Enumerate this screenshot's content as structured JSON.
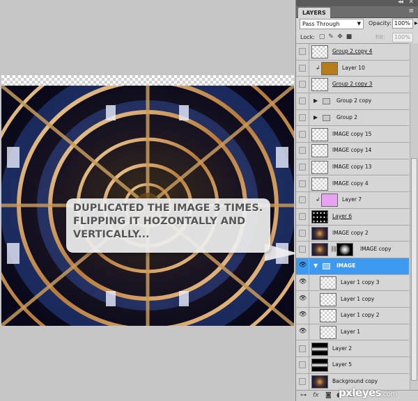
{
  "canvas": {
    "callout": {
      "lines": [
        "DUPLICATED THE IMAGE 3 TIMES.",
        "FLIPPING IT HOZONTALLY AND",
        "VERTICALLY..."
      ]
    }
  },
  "panel": {
    "tab_label": "LAYERS",
    "collapse_glyph": "◂◂",
    "close_glyph": "✕",
    "menu_glyph": "≡",
    "blend_mode": "Pass Through",
    "opacity_label": "Opacity:",
    "opacity_value": "100%",
    "lock_label": "Lock:",
    "fill_label": "Fill:",
    "fill_value": "100%",
    "layers": [
      {
        "name": "Group 2 copy 4",
        "visible": false,
        "thumb": "transparent",
        "underline": true
      },
      {
        "name": "Layer 10",
        "visible": false,
        "thumb": "#b77c1a",
        "clipped": true
      },
      {
        "name": "Group 2 copy 3",
        "visible": false,
        "thumb": "transparent",
        "underline": true
      },
      {
        "name": "Group 2 copy",
        "visible": false,
        "type": "group"
      },
      {
        "name": "Group 2",
        "visible": false,
        "type": "group"
      },
      {
        "name": "IMAGE copy 15",
        "visible": false,
        "thumb": "transparent"
      },
      {
        "name": "IMAGE copy 14",
        "visible": false,
        "thumb": "transparent"
      },
      {
        "name": "IMAGE copy 13",
        "visible": false,
        "thumb": "transparent"
      },
      {
        "name": "IMAGE copy 4",
        "visible": false,
        "thumb": "transparent"
      },
      {
        "name": "Layer 7",
        "visible": false,
        "thumb": "#e7a3f2",
        "clipped": true
      },
      {
        "name": "Layer 6",
        "visible": false,
        "thumb": "#000000",
        "underline": true
      },
      {
        "name": "IMAGE copy 2",
        "visible": false,
        "thumb": "image"
      },
      {
        "name": "IMAGE copy",
        "visible": false,
        "thumb": "image",
        "mask": true
      },
      {
        "name": "IMAGE",
        "visible": true,
        "type": "group",
        "selected": true,
        "expanded": true
      },
      {
        "name": "Layer 1 copy 3",
        "visible": true,
        "thumb": "transparent",
        "indent": true
      },
      {
        "name": "Layer 1 copy",
        "visible": true,
        "thumb": "transparent",
        "indent": true
      },
      {
        "name": "Layer 1 copy 2",
        "visible": true,
        "thumb": "transparent",
        "indent": true
      },
      {
        "name": "Layer 1",
        "visible": true,
        "thumb": "transparent",
        "indent": true
      },
      {
        "name": "Layer 2",
        "visible": false,
        "thumb": "gradient"
      },
      {
        "name": "Layer 5",
        "visible": false,
        "thumb": "gradient"
      },
      {
        "name": "Background copy",
        "visible": false,
        "thumb": "image"
      },
      {
        "name": "Background",
        "visible": false,
        "thumb": "image",
        "italic": true,
        "locked": true
      }
    ],
    "footer_icons": [
      "link-icon",
      "fx-icon",
      "mask-icon",
      "adjustment-icon",
      "folder-icon",
      "new-layer-icon",
      "trash-icon"
    ]
  },
  "watermark": {
    "brand": "pxleyes",
    "suffix": ".com"
  }
}
